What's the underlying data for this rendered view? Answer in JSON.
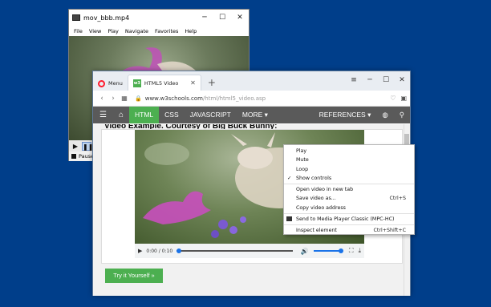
{
  "media_player": {
    "title": "mov_bbb.mp4",
    "window_controls": [
      "─",
      "☐",
      "✕"
    ],
    "menu": [
      "File",
      "View",
      "Play",
      "Navigate",
      "Favorites",
      "Help"
    ],
    "status": "Paused",
    "play_glyph": "▶",
    "pause_glyph": "❚❚"
  },
  "browser": {
    "menu_label": "Menu",
    "tab": {
      "label": "HTML5 Video",
      "favicon": "w3",
      "close": "✕"
    },
    "new_tab": "+",
    "window_controls": [
      "≡",
      "─",
      "☐",
      "✕"
    ],
    "url": {
      "host": "www.w3schools.com",
      "path": "/html/html5_video.asp"
    }
  },
  "w3nav": {
    "items": [
      "HTML",
      "CSS",
      "JAVASCRIPT",
      "MORE ▾"
    ],
    "references": "REFERENCES ▾",
    "active": "HTML"
  },
  "page": {
    "heading_prefix": "Video Example. Courtesy of",
    "heading_link": "Big Buck Bunny:",
    "try_button": "Try it Yourself »"
  },
  "video_controls": {
    "time": "0:00 / 0:10",
    "progress": 0.0,
    "volume": 1.0
  },
  "context_menu": {
    "items": [
      {
        "label": "Play",
        "shortcut": ""
      },
      {
        "label": "Mute",
        "shortcut": ""
      },
      {
        "label": "Loop",
        "shortcut": ""
      },
      {
        "label": "Show controls",
        "shortcut": "",
        "checked": true
      },
      {
        "separator": true
      },
      {
        "label": "Open video in new tab",
        "shortcut": ""
      },
      {
        "label": "Save video as...",
        "shortcut": "Ctrl+S"
      },
      {
        "label": "Copy video address",
        "shortcut": ""
      },
      {
        "separator": true
      },
      {
        "label": "Send to Media Player Classic (MPC-HC)",
        "shortcut": "",
        "icon": "mpc-icon"
      },
      {
        "separator": true
      },
      {
        "label": "Inspect element",
        "shortcut": "Ctrl+Shift+C"
      }
    ]
  },
  "colors": {
    "desktop": "#003e8a",
    "w3_green": "#4caf50",
    "w3_nav": "#5a5a5a",
    "opera_red": "#ff1b2d"
  }
}
